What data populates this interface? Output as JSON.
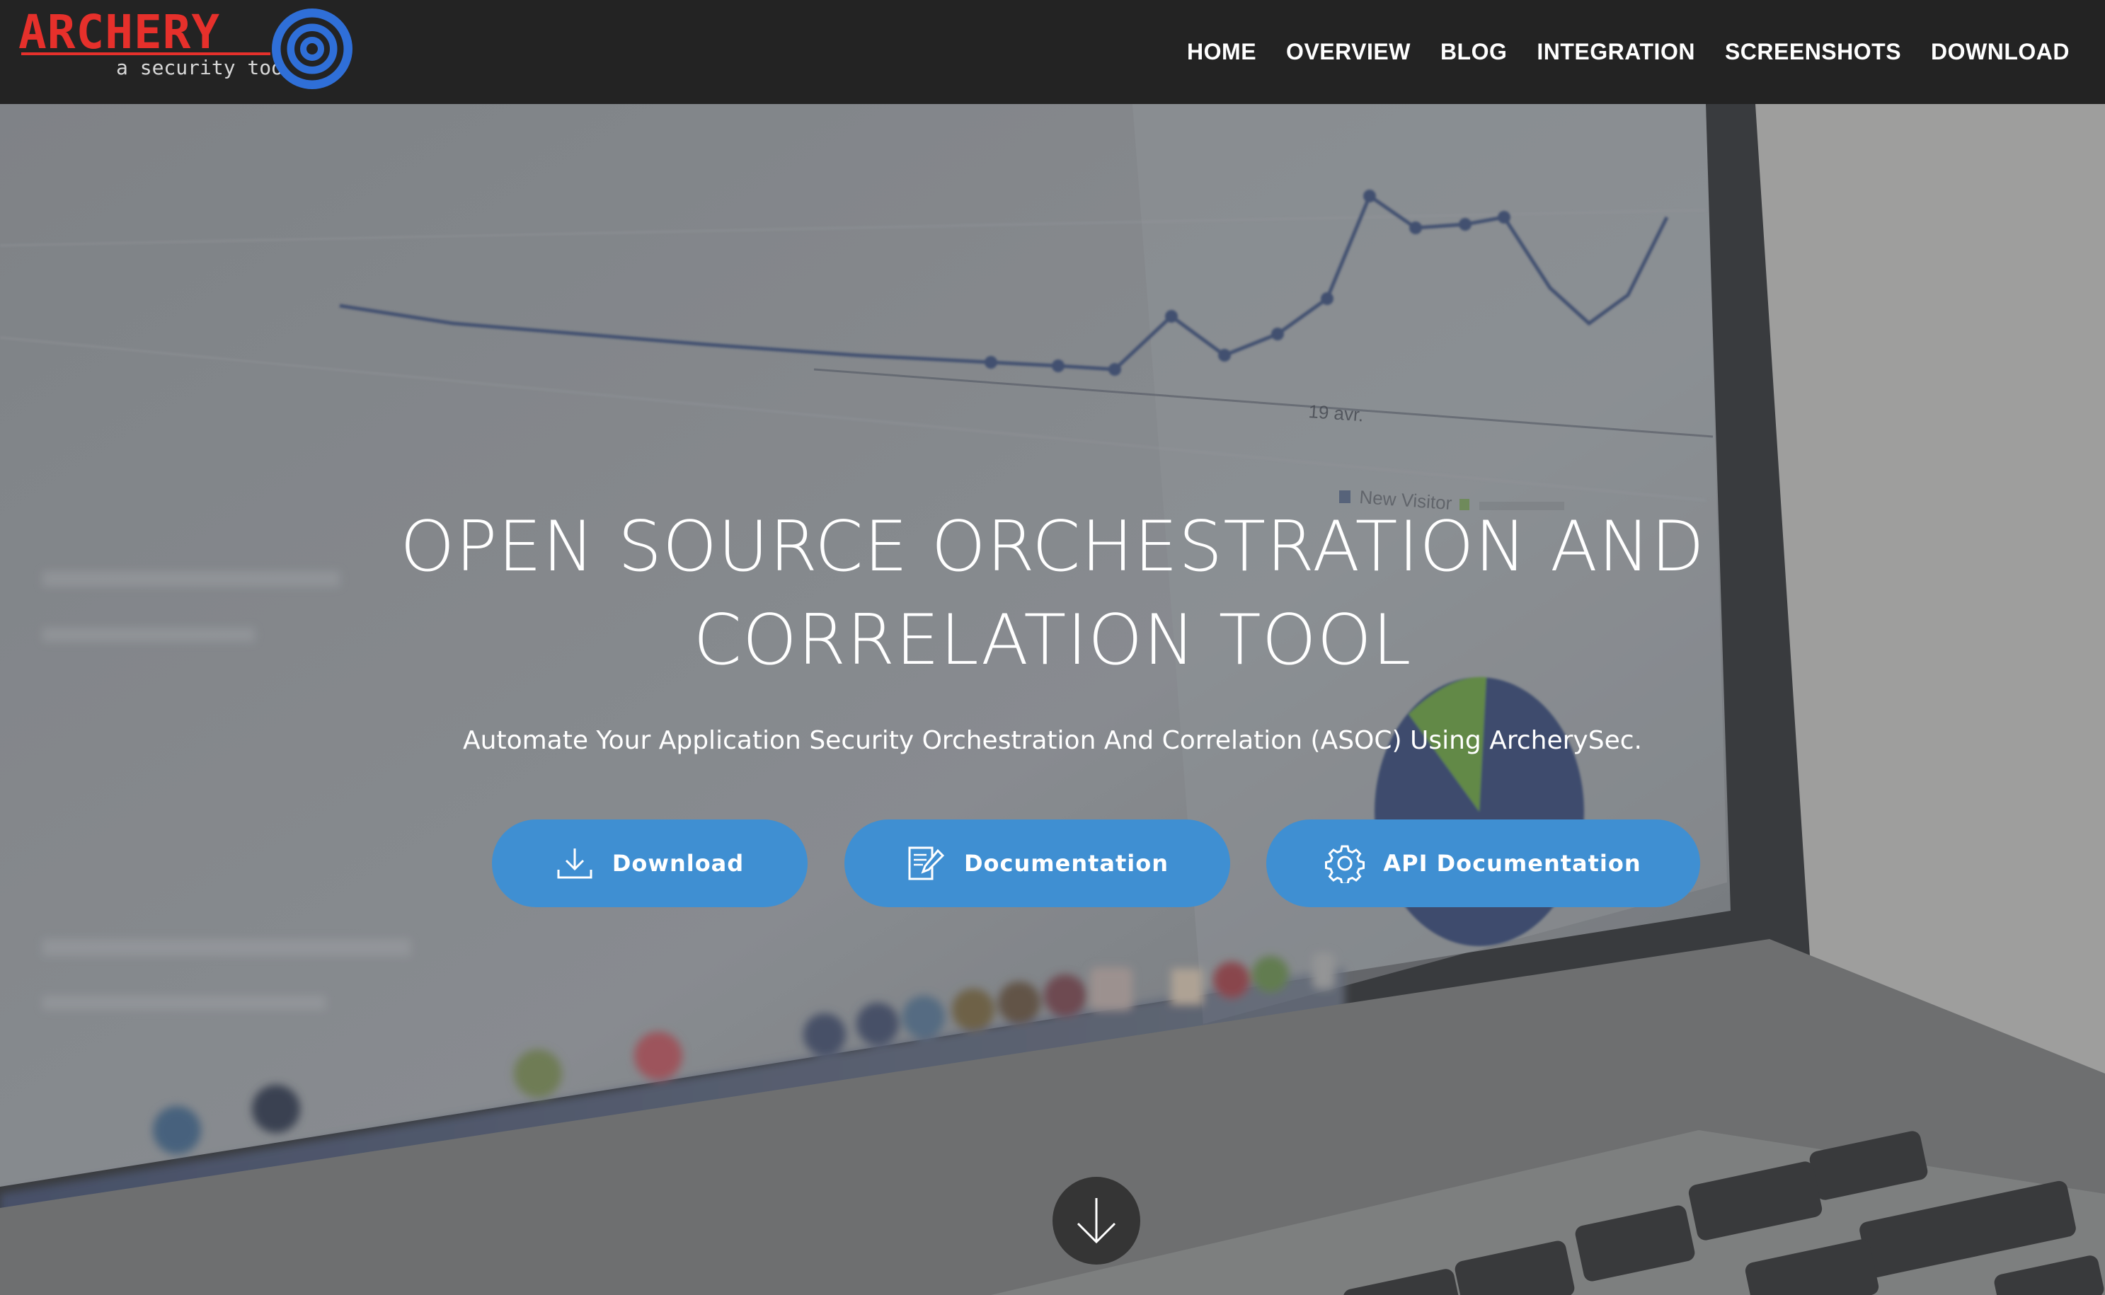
{
  "brand": {
    "name": "ARCHERY",
    "tagline": "a security tool",
    "logo_icon": "target-icon",
    "colors": {
      "logo_red": "#e6302b",
      "logo_blue": "#2f6fd8"
    }
  },
  "nav": {
    "items": [
      {
        "label": "HOME"
      },
      {
        "label": "OVERVIEW"
      },
      {
        "label": "BLOG"
      },
      {
        "label": "INTEGRATION"
      },
      {
        "label": "SCREENSHOTS"
      },
      {
        "label": "DOWNLOAD"
      }
    ]
  },
  "hero": {
    "title_line1": "OPEN SOURCE ORCHESTRATION AND",
    "title_line2": "CORRELATION TOOL",
    "subtitle": "Automate Your Application Security Orchestration And Correlation (ASOC) Using ArcherySec.",
    "background": {
      "date_label": "19 avr.",
      "legend_label": "New Visitor"
    },
    "buttons": [
      {
        "label": "Download",
        "icon": "download-icon"
      },
      {
        "label": "Documentation",
        "icon": "edit-document-icon"
      },
      {
        "label": "API Documentation",
        "icon": "gear-icon"
      }
    ],
    "scroll_icon": "arrow-down-icon",
    "colors": {
      "button": "#3f8fd2",
      "navbar": "#232323"
    }
  }
}
